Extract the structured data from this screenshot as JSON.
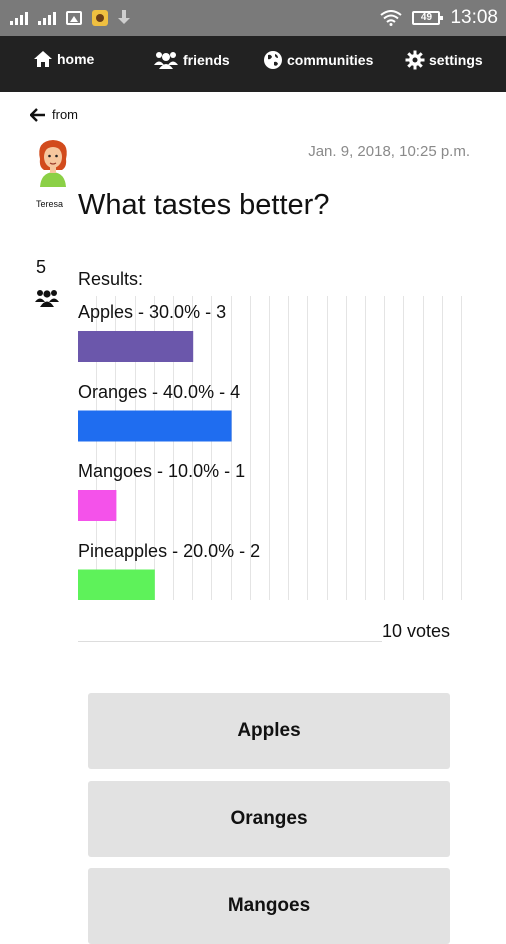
{
  "status_bar": {
    "time": "13:08",
    "battery": "49"
  },
  "nav": {
    "items": [
      {
        "label": "home",
        "icon": "home-icon"
      },
      {
        "label": "friends",
        "icon": "friends-icon"
      },
      {
        "label": "communities",
        "icon": "globe-icon"
      },
      {
        "label": "settings",
        "icon": "gear-icon"
      }
    ]
  },
  "post": {
    "back_label": "from",
    "author": "Teresa",
    "date": "Jan. 9, 2018, 10:25 p.m.",
    "question": "What tastes better?",
    "voters": "5"
  },
  "results": {
    "heading": "Results:",
    "total_votes": "10 votes"
  },
  "chart_data": {
    "type": "bar",
    "orientation": "horizontal",
    "categories": [
      "Apples",
      "Oranges",
      "Mangoes",
      "Pineapples"
    ],
    "labels": [
      "Apples - 30.0% - 3",
      "Oranges - 40.0% - 4",
      "Mangoes - 10.0% - 1",
      "Pineapples - 20.0% - 2"
    ],
    "values": [
      30.0,
      40.0,
      10.0,
      20.0
    ],
    "counts": [
      3,
      4,
      1,
      2
    ],
    "colors": [
      "#6b57ab",
      "#1f6df0",
      "#f452ea",
      "#5ef25a"
    ],
    "xlim": [
      0,
      100
    ],
    "grid": true
  },
  "options": [
    {
      "label": "Apples"
    },
    {
      "label": "Oranges"
    },
    {
      "label": "Mangoes"
    }
  ]
}
